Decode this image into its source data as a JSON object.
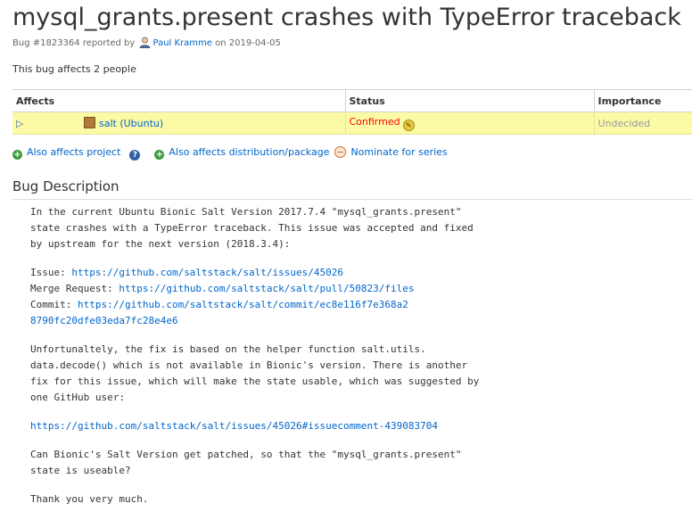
{
  "bug": {
    "title": "mysql_grants.present crashes with TypeError traceback",
    "number_text": "Bug #1823364 reported by",
    "reporter": "Paul Kramme",
    "reported_text": "on 2019-04-05",
    "affects_count_text": "This bug affects 2 people"
  },
  "affects_table": {
    "headers": [
      "Affects",
      "Status",
      "Importance"
    ],
    "rows": [
      {
        "target": "salt (Ubuntu)",
        "status": "Confirmed",
        "importance": "Undecided"
      }
    ]
  },
  "actions": {
    "also_affects_project": "Also affects project",
    "also_affects_distribution": "Also affects distribution/package",
    "nominate": "Nominate for series"
  },
  "description": {
    "heading": "Bug Description",
    "p1": "In the current Ubuntu Bionic Salt Version 2017.7.4 \"mysql_grants.present\"\nstate crashes with a TypeError traceback. This issue was accepted and fixed\nby upstream for the next version (2018.3.4):",
    "issue_label": "Issue: ",
    "issue_url": "https://github.com/saltstack/salt/issues/45026",
    "merge_label": "Merge Request: ",
    "merge_url": "https://github.com/saltstack/salt/pull/50823/files",
    "commit_label": "Commit: ",
    "commit_url": "https://github.com/saltstack/salt/commit/ec8e116f7e368a2\n8790fc20dfe03eda7fc28e4e6",
    "p3": "Unfortunaltely, the fix is based on the helper function salt.utils.\ndata.decode() which is not available in Bionic's version. There is another\nfix for this issue, which will make the state usable, which was suggested by\none GitHub user:",
    "p4_url": "https://github.com/saltstack/salt/issues/45026#issuecomment-439083704",
    "p5": "Can Bionic's Salt Version get patched, so that the \"mysql_grants.present\"\nstate is useable?",
    "p6": "Thank you very much."
  },
  "colors": {
    "link": "#0066cc",
    "confirmed": "#ff0000",
    "row_highlight": "#fbfba6"
  }
}
